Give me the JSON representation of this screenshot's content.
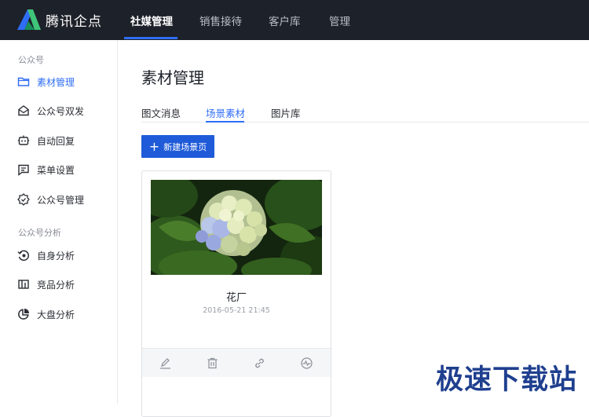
{
  "header": {
    "brand": "腾讯企点",
    "nav": [
      {
        "label": "社媒管理",
        "active": true
      },
      {
        "label": "销售接待",
        "active": false
      },
      {
        "label": "客户库",
        "active": false
      },
      {
        "label": "管理",
        "active": false
      }
    ]
  },
  "sidebar": {
    "groups": [
      {
        "title": "公众号",
        "items": [
          {
            "label": "素材管理",
            "icon": "folder-icon",
            "active": true
          },
          {
            "label": "公众号双发",
            "icon": "mail-open-icon"
          },
          {
            "label": "自动回复",
            "icon": "robot-icon"
          },
          {
            "label": "菜单设置",
            "icon": "menu-list-icon"
          },
          {
            "label": "公众号管理",
            "icon": "gear-badge-icon"
          }
        ]
      },
      {
        "title": "公众号分析",
        "items": [
          {
            "label": "自身分析",
            "icon": "refresh-analysis-icon"
          },
          {
            "label": "竞品分析",
            "icon": "compare-icon"
          },
          {
            "label": "大盘分析",
            "icon": "pie-icon"
          }
        ]
      }
    ]
  },
  "main": {
    "title": "素材管理",
    "tabs": [
      {
        "label": "图文消息",
        "active": false
      },
      {
        "label": "场景素材",
        "active": true
      },
      {
        "label": "图片库",
        "active": false
      }
    ],
    "new_button": "新建场景页",
    "cards": [
      {
        "title": "花厂",
        "date": "2016-05-21 21:45"
      }
    ]
  },
  "watermark": "极速下载站",
  "colors": {
    "accent": "#2f6df6",
    "topbar": "#1d2129",
    "button": "#1f5bd8"
  }
}
